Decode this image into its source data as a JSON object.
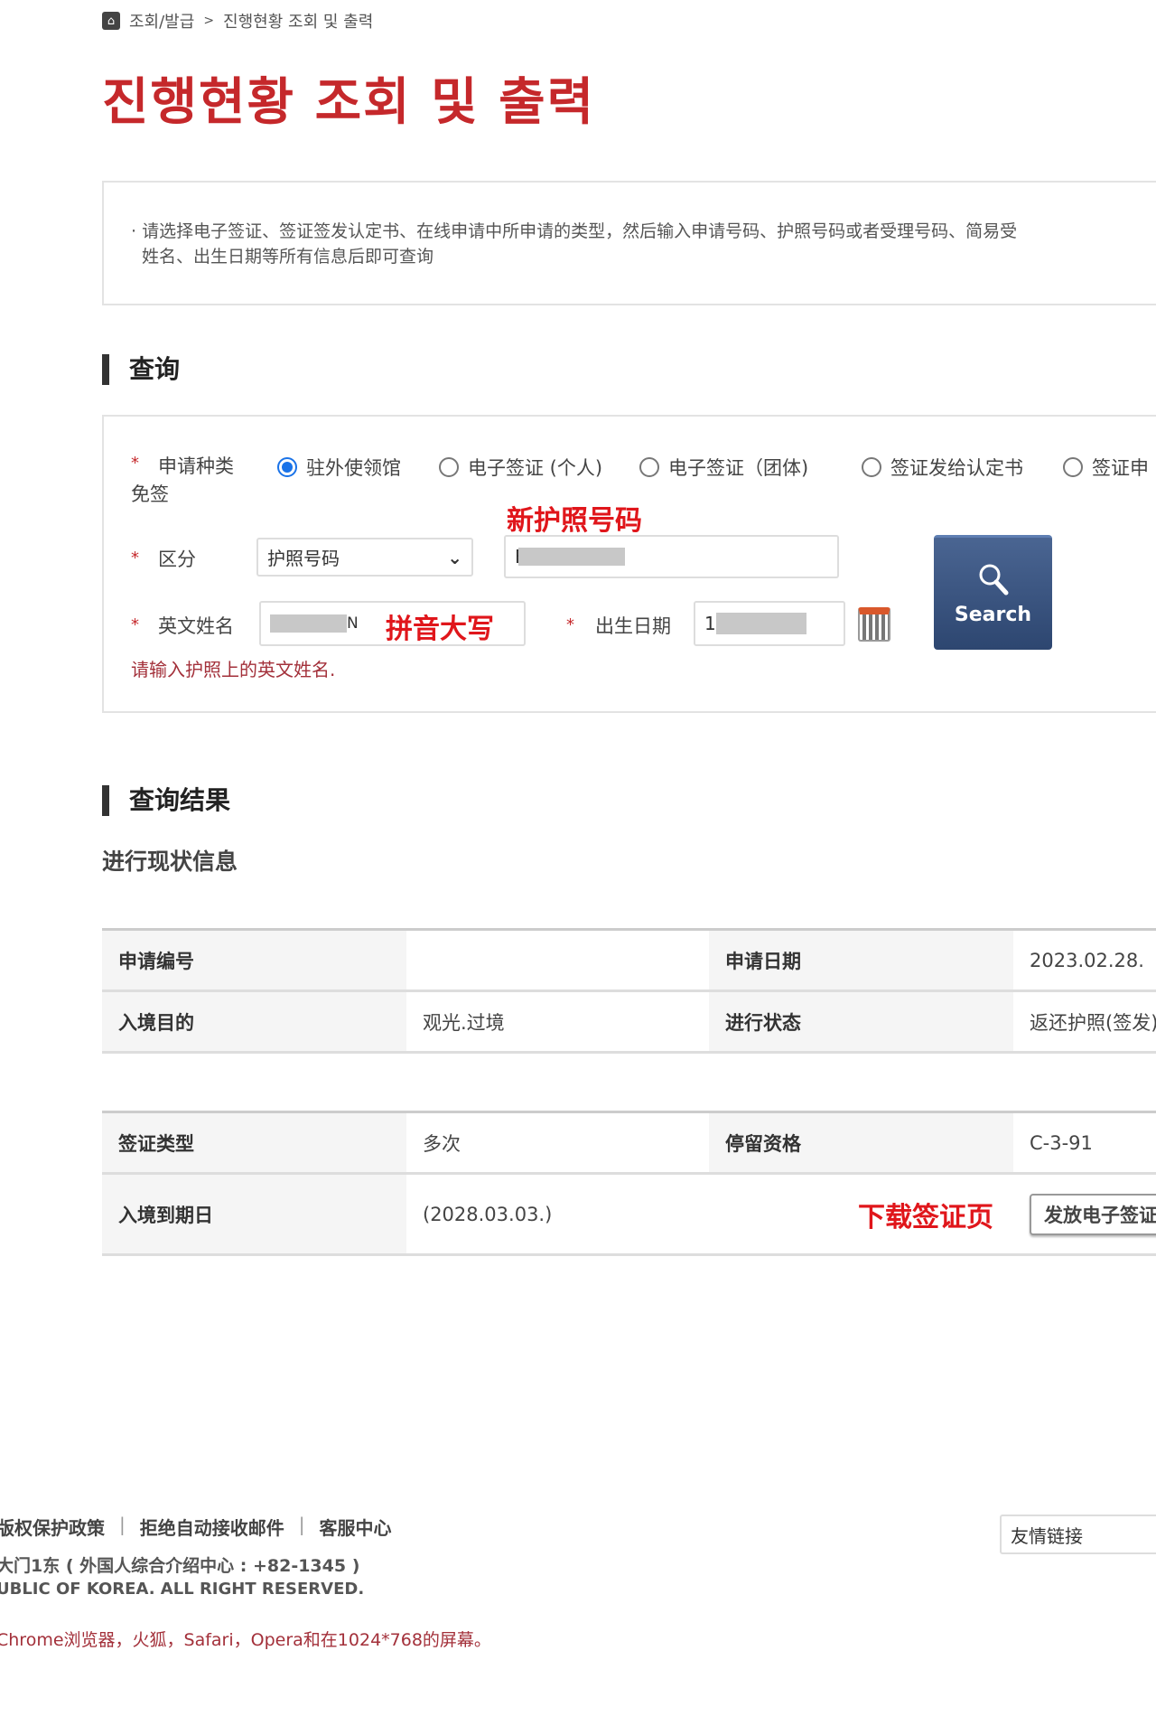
{
  "breadcrumb": {
    "icon": "home-icon",
    "items": [
      "조회/발급",
      "진행현황 조회 및 출력"
    ],
    "separator": ">"
  },
  "page_title": "진행현황 조회 및 출력",
  "notice": {
    "line1": "· 请选择电子签证、签证签发认定书、在线申请中所申请的类型，然后输入申请号码、护照号码或者受理号码、简易受",
    "line2": "姓名、出生日期等所有信息后即可查询"
  },
  "search": {
    "title": "查询",
    "type_label": "申请种类",
    "type_label_wrap": "免签",
    "radios": [
      {
        "label": "驻外使领馆",
        "checked": true
      },
      {
        "label": "电子签证 (个人)",
        "checked": false
      },
      {
        "label": "电子签证（团体)",
        "checked": false
      },
      {
        "label": "签证发给认定书",
        "checked": false
      },
      {
        "label": "签证申",
        "checked": false
      }
    ],
    "category_label": "区分",
    "category_value": "护照号码",
    "passport_value": "E",
    "name_label": "英文姓名",
    "name_value": "N",
    "dob_label": "出生日期",
    "dob_value": "1",
    "hint": "请输入护照上的英文姓名.",
    "button_label": "Search",
    "required_mark": "*",
    "annotations": {
      "passport": "新护照号码",
      "name": "拼音大写"
    }
  },
  "results": {
    "title": "查询结果",
    "subtitle": "进行现状信息",
    "table1": [
      [
        "申请编号",
        "",
        "申请日期",
        "2023.02.28."
      ],
      [
        "入境目的",
        "观光.过境",
        "进行状态",
        "返还护照(签发)"
      ]
    ],
    "table2": [
      [
        "签证类型",
        "多次",
        "停留资格",
        "C-3-91"
      ],
      [
        "入境到期日",
        "(2028.03.03.)",
        "",
        ""
      ]
    ],
    "download_button": "发放电子签证",
    "annotation": "下载签证页"
  },
  "footer": {
    "links": [
      "版权保护政策",
      "拒绝自动接收邮件",
      "客服中心"
    ],
    "address": "大门1东 ( 外国人综合介绍中心 : +82-1345 )",
    "copyright": "UBLIC OF KOREA. ALL RIGHT RESERVED.",
    "browser_note": "Chrome浏览器，火狐，Safari，Opera和在1024*768的屏幕。",
    "related_select": "友情链接"
  },
  "colors": {
    "title": "#c5282b",
    "button": "#2d4670",
    "annotation": "#e0161b"
  }
}
